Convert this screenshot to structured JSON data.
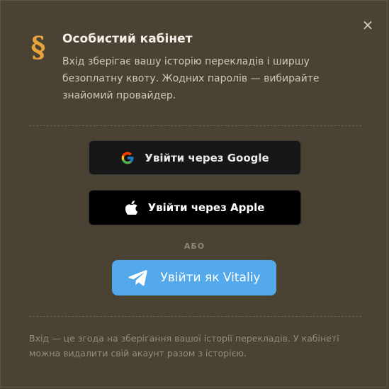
{
  "modal": {
    "close_label": "×",
    "icon_glyph": "§",
    "title": "Особистий кабінет",
    "subtitle": "Вхід зберігає вашу історію перекладів і ширшу безоплатну квоту. Жодних паролів — вибирайте знайомий провайдер."
  },
  "buttons": {
    "google_label": "Увійти через Google",
    "apple_label": "Увійти через Apple",
    "telegram_label": "Увійти як Vitaliy"
  },
  "separator": {
    "or_label": "АБО"
  },
  "footer": {
    "note": "Вхід — це згода на зберігання вашої історії перекладів. У кабінеті можна видалити свій акаунт разом з історією."
  },
  "colors": {
    "background": "#4a4334",
    "accent": "#e8a33d",
    "telegram": "#54a9eb",
    "google_button": "#171717",
    "apple_button": "#000000"
  },
  "icons": {
    "close": "close-icon",
    "section": "section-sign-icon",
    "google": "google-icon",
    "apple": "apple-icon",
    "telegram": "telegram-icon"
  }
}
